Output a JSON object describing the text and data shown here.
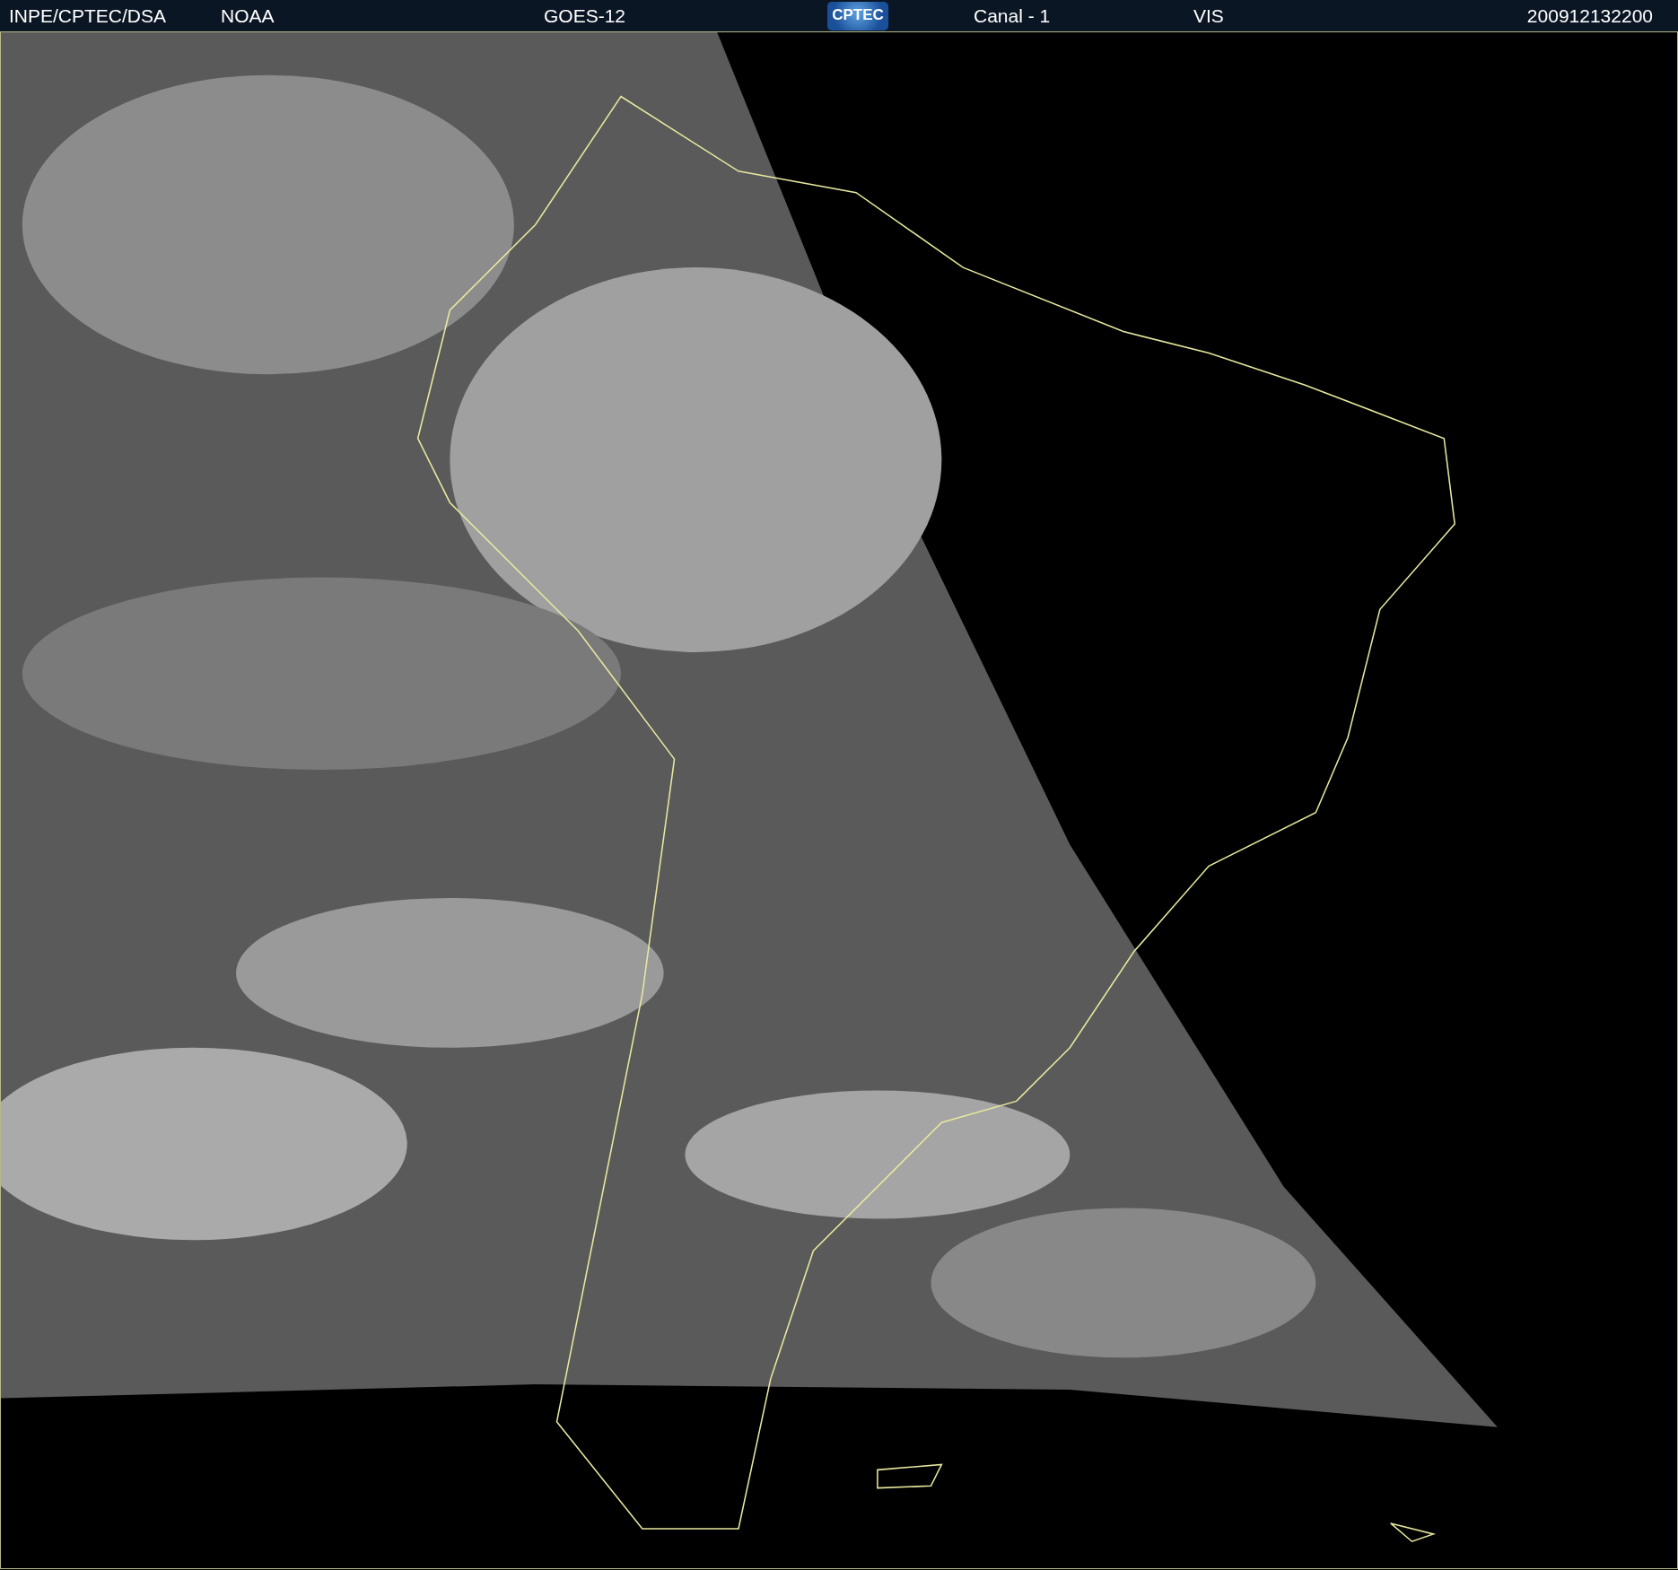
{
  "header": {
    "source": "INPE/CPTEC/DSA",
    "agency": "NOAA",
    "satellite": "GOES-12",
    "logo": "CPTEC",
    "channel": "Canal - 1",
    "band": "VIS",
    "timestamp": "200912132200"
  }
}
